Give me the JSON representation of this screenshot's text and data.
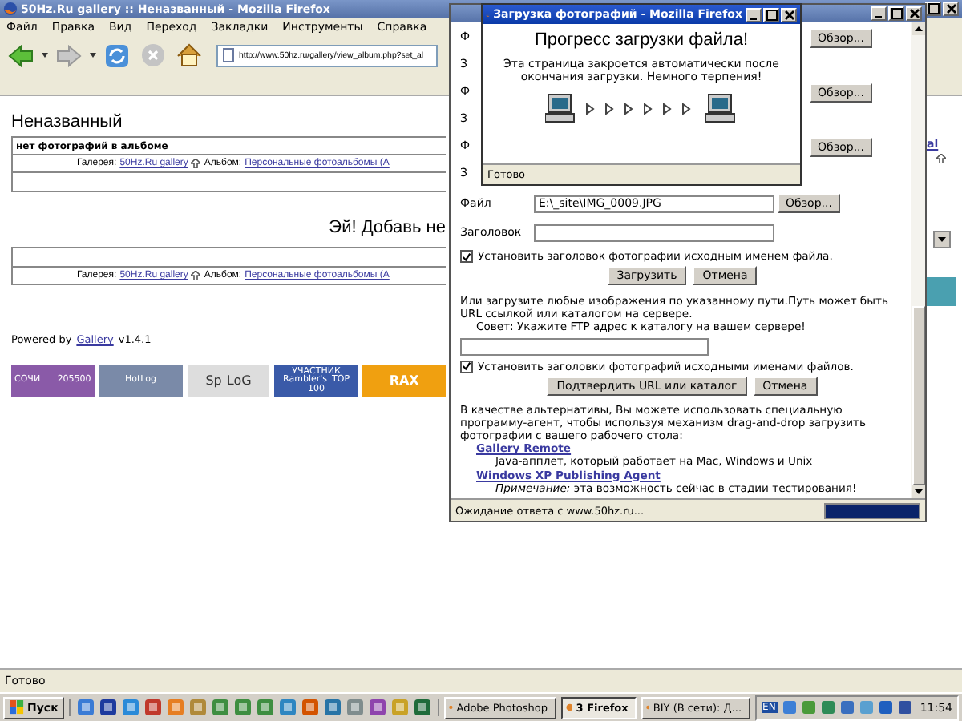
{
  "browser": {
    "title": "50Hz.Ru gallery :: Неназванный - Mozilla Firefox",
    "menu": [
      "Файл",
      "Правка",
      "Вид",
      "Переход",
      "Закладки",
      "Инструменты",
      "Справка"
    ],
    "url": "http://www.50hz.ru/gallery/view_album.php?set_al",
    "status": "Готово"
  },
  "page": {
    "album_title": "Неназванный",
    "empty_notice": "нет фотографий в альбоме",
    "breadcrumbs": [
      {
        "gallery_label": "Галерея:",
        "gallery_link": "50Hz.Ru gallery",
        "album_label": "Альбом:",
        "album_link": "Персональные фотоальбомы (А"
      },
      {
        "gallery_label": "Галерея:",
        "gallery_link": "50Hz.Ru gallery",
        "album_label": "Альбом:",
        "album_link": "Персональные фотоальбомы (А"
      }
    ],
    "add_prompt": "Эй! Добавь не",
    "powered_by": {
      "text": "Powered by",
      "link": "Gallery",
      "version": "v1.4.1"
    },
    "banners": [
      {
        "kind": "sochi",
        "texts": [
          "СОЧИ",
          "205500"
        ]
      },
      {
        "kind": "hotlog",
        "texts": [
          "HotLog"
        ]
      },
      {
        "kind": "spylog",
        "texts": [
          "Sp",
          "LoG"
        ]
      },
      {
        "kind": "rambler",
        "texts": [
          "УЧАСТНИК",
          "Rambler's",
          "TOP",
          "100"
        ]
      },
      {
        "kind": "rax",
        "texts": [
          "RAX"
        ]
      }
    ],
    "right_link": "al"
  },
  "upload_window": {
    "partial_rows": [
      {
        "file_label": "Ф",
        "caption_label": "З",
        "browse": "Обзор..."
      },
      {
        "file_label": "Ф",
        "caption_label": "З",
        "browse": "Обзор..."
      },
      {
        "file_label": "Ф",
        "caption_label": "З",
        "browse": "Обзор..."
      }
    ],
    "file_label": "Файл",
    "file_value": "E:\\_site\\IMG_0009.JPG",
    "browse": "Обзор...",
    "caption_label": "Заголовок",
    "caption_checkbox": {
      "label": "Установить заголовок фотографии исходным именем файла.",
      "checked": true
    },
    "buttons": [
      "Загрузить",
      "Отмена"
    ],
    "url_intro": "Или загрузите любые изображения по указанному пути.Путь может быть URL ссылкой или каталогом на сервере.",
    "tip": "Совет: Укажите FTP адрес к каталогу на вашем сервере!",
    "url_checkbox": {
      "label": "Установить заголовки фотографий исходными именами файлов.",
      "checked": true
    },
    "url_buttons": [
      "Подтвердить URL или каталог",
      "Отмена"
    ],
    "alt_intro": "В качестве альтернативы, Вы можете использовать специальную программу-агент, чтобы используя механизм drag-and-drop загрузить фотографии с вашего рабочего стола:",
    "agents": [
      {
        "name": "Gallery Remote",
        "description": "Java-апплет, который работает на Mac, Windows и Unix"
      },
      {
        "name": "Windows XP Publishing Agent",
        "description": "*Примечание:* эта возможность сейчас в стадии тестирования!"
      }
    ],
    "status": "Ожидание ответа с www.50hz.ru...",
    "progress": {
      "level": 1
    }
  },
  "popup": {
    "title": "Загрузка фотографий - Mozilla Firefox",
    "heading": "Прогресс загрузки файла!",
    "message": "Эта страница закроется автоматически после окончания загрузки. Немного терпения!",
    "status": "Готово"
  },
  "taskbar": {
    "start": "Пуск",
    "tasks": [
      {
        "label": "Adobe Photoshop",
        "selected": false
      },
      {
        "label": "3 Firefox",
        "selected": true
      },
      {
        "label": "BIY (В сети): Д...",
        "selected": false
      }
    ],
    "language": "EN",
    "clock": "11:54"
  }
}
